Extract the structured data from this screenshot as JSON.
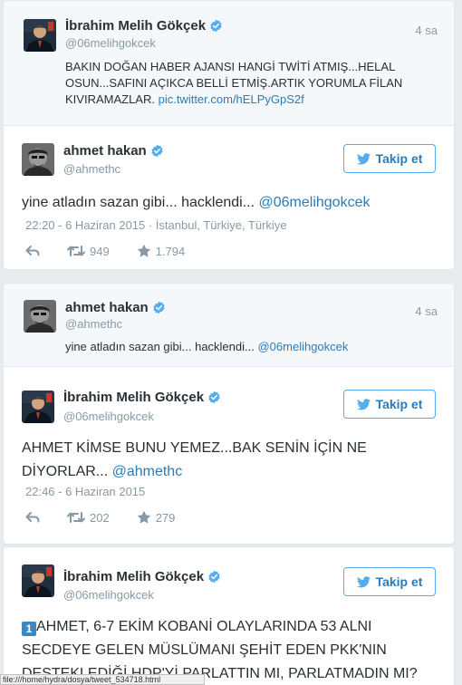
{
  "colors": {
    "link": "#2b7bb9",
    "verified": "#55acee",
    "follow_border": "#55acee",
    "muted": "#8899a6"
  },
  "card1": {
    "quoted": {
      "name": "İbrahim Melih Gökçek",
      "handle": "@06melihgokcek",
      "time": "4 sa",
      "text": "BAKIN DOĞAN HABER AJANSI HANGİ TWİTİ ATMIŞ...HELAL OSUN...SAFINI AÇIKCA BELLİ ETMİŞ.ARTIK YORUMLA FİLAN KIVIRAMAZLAR.",
      "link": "pic.twitter.com/hELPyGpS2f"
    },
    "tweet": {
      "name": "ahmet hakan",
      "handle": "@ahmethc",
      "follow_label": "Takip et",
      "text": "yine atladın sazan gibi... hacklendi...",
      "mention": "@06melihgokcek",
      "meta": "22:20 - 6 Haziran 2015 · İstanbul, Türkiye, Türkiye",
      "retweets": "949",
      "favorites": "1.794"
    }
  },
  "card2": {
    "quoted": {
      "name": "ahmet hakan",
      "handle": "@ahmethc",
      "time": "4 sa",
      "text": "yine atladın sazan gibi... hacklendi...",
      "mention": "@06melihgokcek"
    },
    "tweet": {
      "name": "İbrahim Melih Gökçek",
      "handle": "@06melihgokcek",
      "follow_label": "Takip et",
      "text": "AHMET KİMSE BUNU YEMEZ...BAK SENİN İÇİN NE DİYORLAR...",
      "mention": "@ahmethc",
      "meta": "22:46 - 6 Haziran 2015",
      "retweets": "202",
      "favorites": "279"
    }
  },
  "card3": {
    "tweet": {
      "name": "İbrahim Melih Gökçek",
      "handle": "@06melihgokcek",
      "follow_label": "Takip et",
      "badge": "1",
      "text": "AHMET, 6-7 EKİM KOBANİ OLAYLARINDA 53 ALNI SECDEYE GELEN MÜSLÜMANI ŞEHİT EDEN PKK'NIN DESTEKLEDİĞİ HDP'Yİ PARLATTIN MI, PARLATMADIN MI?"
    }
  },
  "statusbar": {
    "text": "file:///home/hydra/dosya/tweet_534718.html"
  }
}
